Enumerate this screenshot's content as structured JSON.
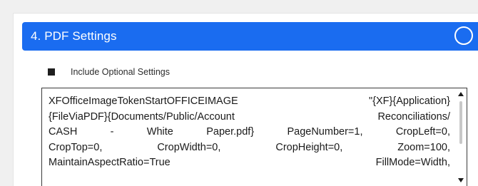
{
  "section": {
    "title": "4. PDF Settings",
    "toggle_icon": "circle-icon"
  },
  "options": {
    "include_optional_label": "Include Optional Settings",
    "include_optional_checked": true
  },
  "token_field": {
    "lines": [
      "XFOfficeImageTokenStartOFFICEIMAGE \"{XF}{Application}",
      "{FileViaPDF}{Documents/Public/Account Reconciliations/",
      "CASH - White Paper.pdf} PageNumber=1, CropLeft=0,",
      "CropTop=0, CropWidth=0, CropHeight=0, Zoom=100,",
      "MaintainAspectRatio=True FillMode=Width,"
    ]
  },
  "colors": {
    "header_bg": "#1a6cf0",
    "header_text": "#ffffff"
  }
}
